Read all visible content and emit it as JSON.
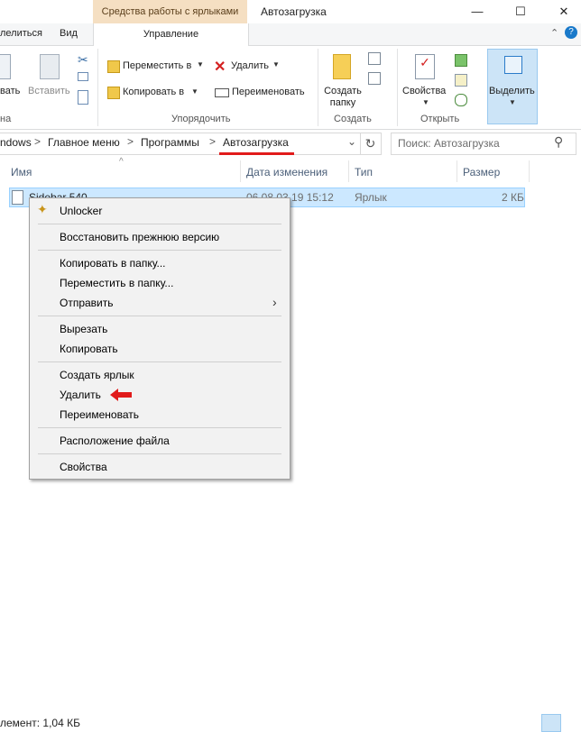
{
  "titlebar": {
    "context_tab": "Средства работы с ярлыками",
    "window_title": "Автозагрузка",
    "minimize": "—",
    "maximize": "☐",
    "close": "✕"
  },
  "ribbon_tabs": {
    "share": "лелиться",
    "view": "Вид",
    "manage": "Управление",
    "collapse": "⌃",
    "help": "?"
  },
  "ribbon": {
    "clipboard": {
      "paste": "вать",
      "paste_shortcut": "Вставить",
      "group": "на"
    },
    "organize": {
      "move_to": "Переместить в",
      "copy_to": "Копировать в",
      "delete": "Удалить",
      "rename": "Переименовать",
      "group": "Упорядочить"
    },
    "new": {
      "new_folder_line1": "Создать",
      "new_folder_line2": "папку",
      "group": "Создать"
    },
    "open": {
      "properties": "Свойства",
      "group": "Открыть"
    },
    "select": {
      "select": "Выделить"
    }
  },
  "address": {
    "crumbs": [
      "ndows",
      "Главное меню",
      "Программы",
      "Автозагрузка"
    ],
    "separator": ">",
    "dropdown": "⌄",
    "refresh": "↻",
    "search_placeholder": "Поиск: Автозагрузка"
  },
  "columns": {
    "name": "Имя",
    "date": "Дата изменения",
    "type": "Тип",
    "size": "Размер",
    "sort_indicator": "^"
  },
  "file": {
    "name": "Sidebar 540",
    "date": "06.08.03.19 15:12",
    "type": "Ярлык",
    "size": "2 КБ"
  },
  "context_menu": {
    "unlocker": "Unlocker",
    "restore": "Восстановить прежнюю версию",
    "copy_to_folder": "Копировать в папку...",
    "move_to_folder": "Переместить в папку...",
    "send_to": "Отправить",
    "cut": "Вырезать",
    "copy": "Копировать",
    "create_shortcut": "Создать ярлык",
    "delete": "Удалить",
    "rename": "Переименовать",
    "file_location": "Расположение файла",
    "properties": "Свойства"
  },
  "status": {
    "text": "лемент: 1,04 КБ"
  },
  "colors": {
    "accent": "#cce8ff",
    "context_tab": "#f5dfc2",
    "arrow": "#e11b1b"
  }
}
